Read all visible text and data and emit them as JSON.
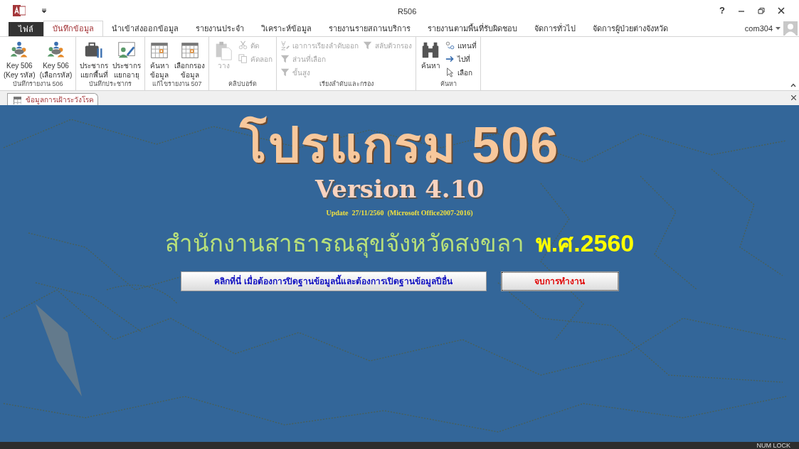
{
  "window": {
    "title": "R506",
    "help": "?",
    "user": "com304"
  },
  "ribbon_tabs": [
    {
      "label": "ไฟล์",
      "kind": "file",
      "selected": false
    },
    {
      "label": "บันทึกข้อมูล",
      "kind": "tab",
      "selected": true
    },
    {
      "label": "นำเข้าส่งออกข้อมูล",
      "kind": "tab",
      "selected": false
    },
    {
      "label": "รายงานประจำ",
      "kind": "tab",
      "selected": false
    },
    {
      "label": "วิเคราะห์ข้อมูล",
      "kind": "tab",
      "selected": false
    },
    {
      "label": "รายงานรายสถานบริการ",
      "kind": "tab",
      "selected": false
    },
    {
      "label": "รายงานตามพื้นที่รับผิดชอบ",
      "kind": "tab",
      "selected": false
    },
    {
      "label": "จัดการทั่วไป",
      "kind": "tab",
      "selected": false
    },
    {
      "label": "จัดการผู้ป่วยต่างจังหวัด",
      "kind": "tab",
      "selected": false
    }
  ],
  "ribbon_groups": [
    {
      "label": "บันทึกรายงาน 506",
      "commands": [
        {
          "kind": "large",
          "lines": [
            "Key 506",
            "(Key รหัส)"
          ],
          "disabled": false
        },
        {
          "kind": "large",
          "lines": [
            "Key 506",
            "(เลือกรหัส)"
          ],
          "disabled": false
        }
      ]
    },
    {
      "label": "บันทึกประชากร",
      "commands": [
        {
          "kind": "large",
          "lines": [
            "ประชากร",
            "แยกพื้นที่"
          ],
          "disabled": false
        },
        {
          "kind": "large",
          "lines": [
            "ประชากร",
            "แยกอายุ"
          ],
          "disabled": false
        }
      ]
    },
    {
      "label": "แก้ไขรายงาน 507",
      "commands": [
        {
          "kind": "large",
          "lines": [
            "ค้นหา",
            "ข้อมูล"
          ],
          "disabled": false
        },
        {
          "kind": "large",
          "lines": [
            "เลือกกรอง",
            "ข้อมูล"
          ],
          "disabled": false
        }
      ]
    },
    {
      "label": "คลิปบอร์ด",
      "commands": [
        {
          "kind": "large",
          "lines": [
            "วาง"
          ],
          "disabled": true
        },
        {
          "kind": "small",
          "lines": [
            "ตัด"
          ],
          "disabled": true
        },
        {
          "kind": "small",
          "lines": [
            "คัดลอก"
          ],
          "disabled": true
        }
      ]
    },
    {
      "label": "เรียงลำดับและกรอง",
      "commands": [
        {
          "kind": "small",
          "lines": [
            "เอาการเรียงลำดับออก"
          ],
          "disabled": true
        },
        {
          "kind": "small",
          "lines": [
            "ส่วนที่เลือก"
          ],
          "disabled": true
        },
        {
          "kind": "small",
          "lines": [
            "ขั้นสูง"
          ],
          "disabled": true
        },
        {
          "kind": "small",
          "lines": [
            "สลับตัวกรอง"
          ],
          "disabled": true
        }
      ]
    },
    {
      "label": "ค้นหา",
      "commands": [
        {
          "kind": "large",
          "lines": [
            "ค้นหา"
          ],
          "disabled": false
        },
        {
          "kind": "small",
          "lines": [
            "แทนที่"
          ],
          "disabled": false
        },
        {
          "kind": "small",
          "lines": [
            "ไปที่"
          ],
          "disabled": false
        },
        {
          "kind": "small",
          "lines": [
            "เลือก"
          ],
          "disabled": false
        }
      ]
    }
  ],
  "document_tab": {
    "label": "ข้อมูลการเฝ้าระวังโรค",
    "selected": true
  },
  "splash": {
    "title": "โปรแกรม 506",
    "version": "Version 4.10",
    "update": "Update  27/11/2560  (Microsoft Office2007-2016)",
    "office": "สำนักงานสาธารณสุขจังหวัดสงขลา",
    "year": "พ.ศ.2560",
    "buttons": [
      {
        "label": "คลิกที่นี่ เมื่อต้องการปิดฐานข้อมูลนี้และต้องการเปิดฐานข้อมูลปีอื่น",
        "kind": "open"
      },
      {
        "label": "จบการทำงาน",
        "kind": "exit"
      }
    ]
  },
  "status_bar": {
    "right": "NUM LOCK"
  }
}
